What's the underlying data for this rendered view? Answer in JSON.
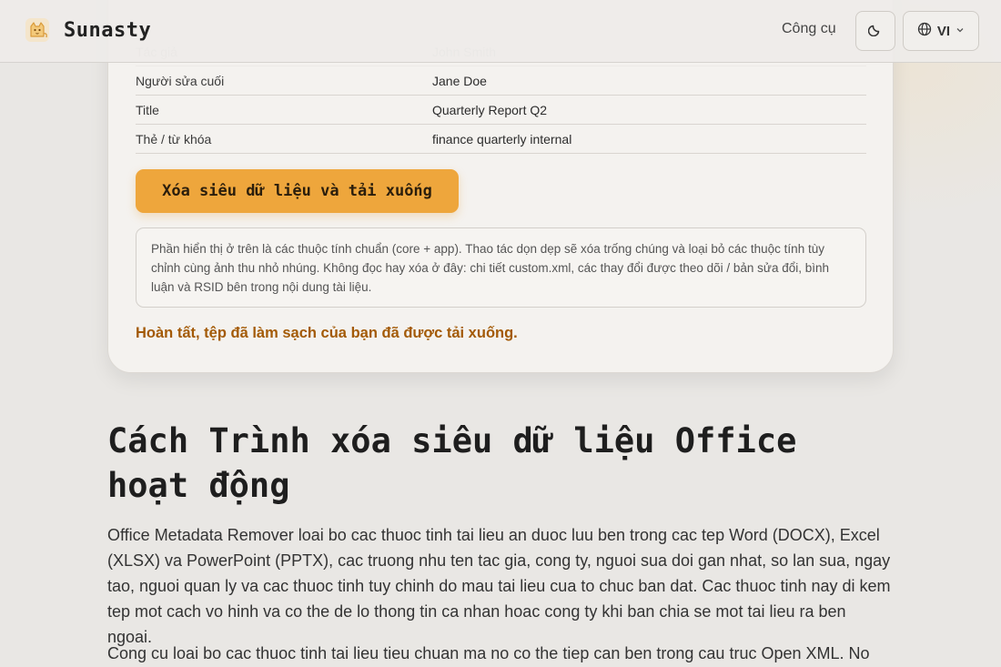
{
  "header": {
    "brand": "Sunasty",
    "nav_tools": "Công cụ",
    "lang": "VI"
  },
  "properties": [
    {
      "label": "Tác giả",
      "value": "John Smith",
      "faded": true
    },
    {
      "label": "Người sửa cuối",
      "value": "Jane Doe"
    },
    {
      "label": "Title",
      "value": "Quarterly Report Q2"
    },
    {
      "label": "Thẻ / từ khóa",
      "value": "finance quarterly internal"
    }
  ],
  "clean_button": "Xóa siêu dữ liệu và tải xuống",
  "info_text": "Phần hiển thị ở trên là các thuộc tính chuẩn (core + app). Thao tác dọn dẹp sẽ xóa trống chúng và loại bỏ các thuộc tính tùy chỉnh cùng ảnh thu nhỏ nhúng. Không đọc hay xóa ở đây: chi tiết custom.xml, các thay đổi được theo dõi / bản sửa đổi, bình luận và RSID bên trong nội dung tài liệu.",
  "success_message": "Hoàn tất, tệp đã làm sạch của bạn đã được tải xuống.",
  "article": {
    "title": "Cách Trình xóa siêu dữ liệu Office hoạt động",
    "paragraphs": [
      "Office Metadata Remover loai bo cac thuoc tinh tai lieu an duoc luu ben trong cac tep Word (DOCX), Excel (XLSX) va PowerPoint (PPTX), cac truong nhu ten tac gia, cong ty, nguoi sua doi gan nhat, so lan sua, ngay tao, nguoi quan ly va cac thuoc tinh tuy chinh do mau tai lieu cua to chuc ban dat. Cac thuoc tinh nay di kem tep mot cach vo hinh va co the de lo thong tin ca nhan hoac cong ty khi ban chia se mot tai lieu ra ben ngoai.",
      "Cong cu loai bo cac thuoc tinh tai lieu tieu chuan ma no co the tiep can ben trong cau truc Open XML. No"
    ]
  },
  "colors": {
    "accent": "#eea63c",
    "success": "#a35a06",
    "background": "#e9e7e4"
  }
}
